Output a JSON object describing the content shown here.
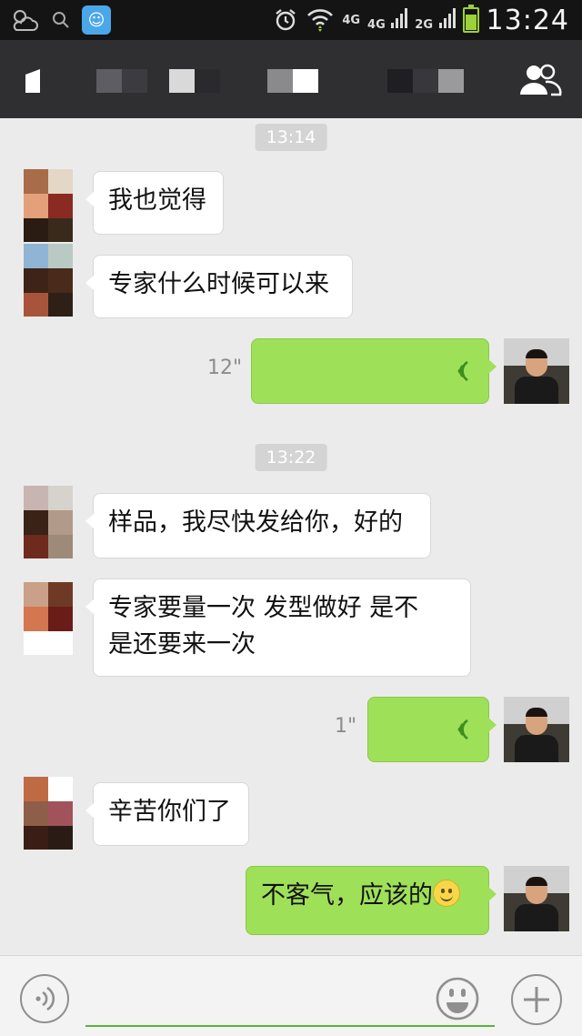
{
  "status_bar": {
    "time": "13:24",
    "networks": [
      "4G",
      "4G",
      "2G"
    ],
    "icons": [
      "weather-icon",
      "search-icon",
      "app-notification-icon",
      "alarm-icon",
      "wifi-icon",
      "battery-icon"
    ]
  },
  "title_bar": {
    "icons": [
      "back-icon",
      "members-icon"
    ]
  },
  "messages": [
    {
      "type": "timestamp",
      "text": "13:14"
    },
    {
      "type": "text",
      "side": "in",
      "text": "我也觉得"
    },
    {
      "type": "text",
      "side": "in",
      "text": "专家什么时候可以来"
    },
    {
      "type": "voice",
      "side": "out",
      "duration": "12\""
    },
    {
      "type": "timestamp",
      "text": "13:22"
    },
    {
      "type": "text",
      "side": "in",
      "text": "样品，我尽快发给你，好的"
    },
    {
      "type": "text",
      "side": "in",
      "lines": [
        "专家要量一次  发型做好 是不",
        "是还要来一次"
      ]
    },
    {
      "type": "voice",
      "side": "out",
      "duration": "1\""
    },
    {
      "type": "text",
      "side": "in",
      "text": "辛苦你们了"
    },
    {
      "type": "text",
      "side": "out",
      "text": "不客气，应该的",
      "emoji": "smile-emoji"
    }
  ],
  "input_bar": {
    "placeholder": "",
    "icons": [
      "voice-input-icon",
      "emoji-icon",
      "plus-icon"
    ]
  },
  "colors": {
    "outgoing_bubble": "#9fe059",
    "incoming_bubble": "#ffffff",
    "chat_background": "#ebebeb",
    "title_bar": "#2f2f31",
    "status_bar": "#141414"
  }
}
